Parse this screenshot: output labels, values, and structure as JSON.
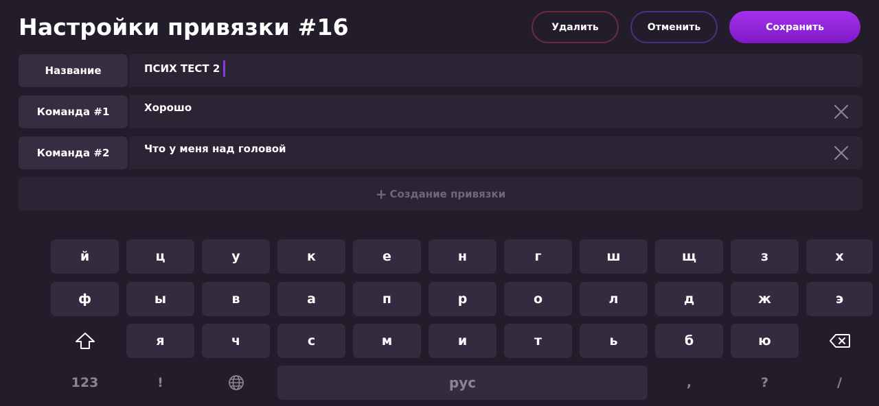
{
  "header": {
    "title": "Настройки привязки #16",
    "delete_label": "Удалить",
    "cancel_label": "Отменить",
    "save_label": "Сохранить"
  },
  "fields": {
    "name": {
      "label": "Название",
      "value": "ПСИХ ТЕСТ 2"
    },
    "commands": [
      {
        "label": "Команда #1",
        "value": "Хорошо"
      },
      {
        "label": "Команда #2",
        "value": "Что у меня над головой"
      }
    ]
  },
  "create": {
    "plus": "+",
    "label": "Создание привязки"
  },
  "keyboard": {
    "row1": [
      "й",
      "ц",
      "у",
      "к",
      "е",
      "н",
      "г",
      "ш",
      "щ",
      "з",
      "х"
    ],
    "row2": [
      "ф",
      "ы",
      "в",
      "а",
      "п",
      "р",
      "о",
      "л",
      "д",
      "ж",
      "э"
    ],
    "row3": [
      "я",
      "ч",
      "с",
      "м",
      "и",
      "т",
      "ь",
      "б",
      "ю"
    ],
    "row4": {
      "numbers": "123",
      "exclaim": "!",
      "space": "рус",
      "comma": ",",
      "question": "?",
      "slash": "/"
    }
  },
  "colors": {
    "background": "#231d2b",
    "accent": "#9b2ee6",
    "delete_border": "#6a2c3c",
    "cancel_border": "#4e2f7a"
  },
  "icons": {
    "remove": "close-icon",
    "shift": "shift-icon",
    "backspace": "backspace-icon",
    "language": "globe-icon"
  }
}
